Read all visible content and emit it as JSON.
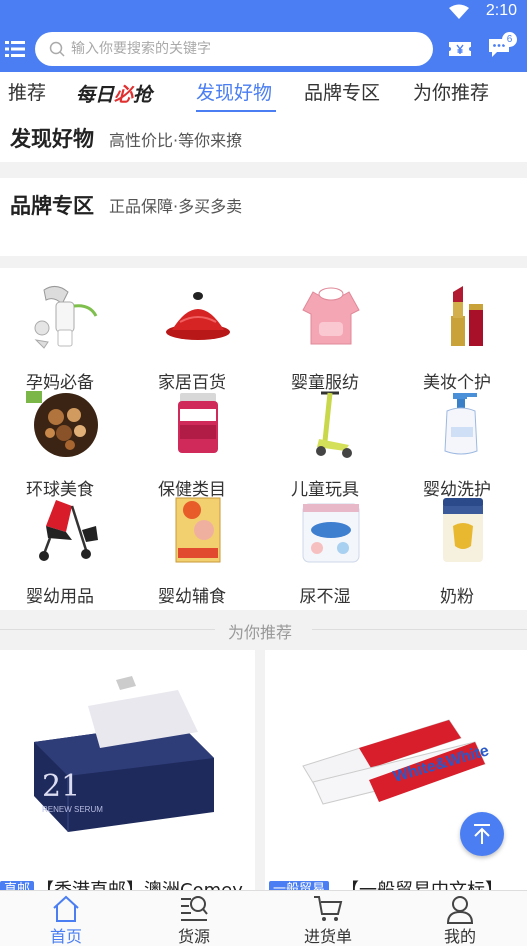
{
  "status": {
    "time": "2:10"
  },
  "search": {
    "placeholder": "输入你要搜索的关键字"
  },
  "header": {
    "message_badge": "6"
  },
  "tabs": [
    {
      "label": "推荐",
      "active": false
    },
    {
      "label_parts": [
        "每日",
        "必",
        "抢"
      ],
      "active": false
    },
    {
      "label": "发现好物",
      "active": true
    },
    {
      "label": "品牌专区",
      "active": false
    },
    {
      "label": "为你推荐",
      "active": false
    }
  ],
  "sections": {
    "discover": {
      "title": "发现好物",
      "subtitle": "高性价比·等你来撩"
    },
    "brand": {
      "title": "品牌专区",
      "subtitle": "正品保障·多买多卖"
    }
  },
  "categories": [
    {
      "label": "孕妈必备",
      "icon": "breast-pump-icon"
    },
    {
      "label": "家居百货",
      "icon": "tagine-pot-icon"
    },
    {
      "label": "婴童服纺",
      "icon": "baby-bib-icon"
    },
    {
      "label": "美妆个护",
      "icon": "lipstick-icon"
    },
    {
      "label": "环球美食",
      "icon": "mixed-nuts-icon"
    },
    {
      "label": "保健类目",
      "icon": "supplement-bottle-icon"
    },
    {
      "label": "儿童玩具",
      "icon": "kick-scooter-icon"
    },
    {
      "label": "婴幼洗护",
      "icon": "baby-lotion-icon"
    },
    {
      "label": "婴幼用品",
      "icon": "stroller-icon"
    },
    {
      "label": "婴幼辅食",
      "icon": "cereal-box-icon"
    },
    {
      "label": "尿不湿",
      "icon": "diaper-pack-icon"
    },
    {
      "label": "奶粉",
      "icon": "formula-can-icon"
    }
  ],
  "recommend": {
    "divider_text": "为你推荐"
  },
  "products": [
    {
      "badge": "直邮",
      "title": "【香港直邮】澳洲Comey",
      "box_text": "21",
      "box_subtext": "RENEW SERUM"
    },
    {
      "badge": "一般贸易",
      "title": "【一般贸易中文标】",
      "box_text": "White&White"
    }
  ],
  "bottom_nav": [
    {
      "label": "首页",
      "icon": "home-icon",
      "active": true
    },
    {
      "label": "货源",
      "icon": "search-list-icon",
      "active": false
    },
    {
      "label": "进货单",
      "icon": "cart-icon",
      "active": false
    },
    {
      "label": "我的",
      "icon": "user-icon",
      "active": false
    }
  ],
  "colors": {
    "accent": "#4a7ef2",
    "hot_red": "#e03030",
    "background": "#f2f2f2"
  }
}
